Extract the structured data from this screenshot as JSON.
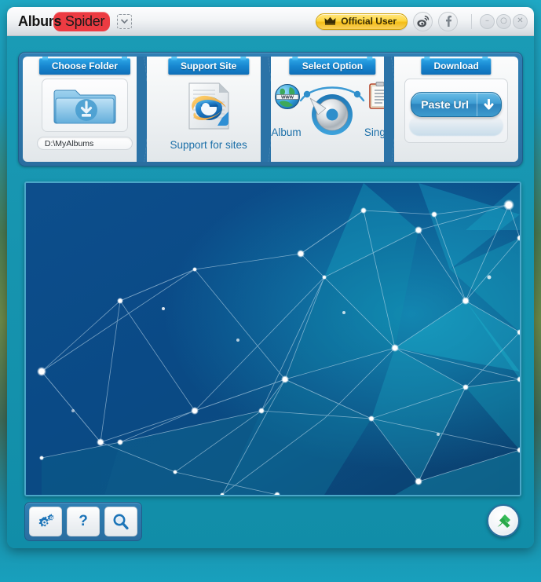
{
  "window": {
    "logo_primary": "Album",
    "logo_pill_bold": "s",
    "logo_pill_rest": "Spider",
    "dropdown_icon": "chevron-down-icon",
    "official_badge": "Official User",
    "badge_icon": "crown-icon",
    "social": [
      {
        "name": "weibo-icon",
        "glyph": "◉"
      },
      {
        "name": "facebook-icon",
        "glyph": "f"
      }
    ],
    "controls": [
      {
        "name": "minimize-button",
        "glyph": "–"
      },
      {
        "name": "maximize-button",
        "glyph": "○"
      },
      {
        "name": "close-button",
        "glyph": "✕"
      }
    ]
  },
  "toolbar": {
    "tabs": [
      {
        "label": "Choose Folder"
      },
      {
        "label": "Support Site"
      },
      {
        "label": "Select Option"
      },
      {
        "label": "Download"
      }
    ],
    "choose_folder": {
      "icon": "download-folder-icon",
      "path_value": "D:\\MyAlbums",
      "path_placeholder": "D:\\MyAlbums"
    },
    "support_site": {
      "icon": "internet-explorer-document-icon",
      "caption": "Support for sites"
    },
    "select_option": {
      "left_label": "Album",
      "right_label": "Single",
      "left_icon": "www-globe-icon",
      "right_icon": "clipboard-icon",
      "dial_icon": "rotary-dial-knob",
      "selected": "Album"
    },
    "download": {
      "button_label": "Paste Url",
      "button_icon": "download-arrow-icon"
    }
  },
  "preview": {
    "name": "preview-image-network-background",
    "alt": "Low-poly network constellation background"
  },
  "bottom": {
    "buttons": [
      {
        "name": "settings-button",
        "icon": "gears-icon"
      },
      {
        "name": "help-button",
        "icon": "question-mark-icon",
        "glyph": "?"
      },
      {
        "name": "search-button",
        "icon": "magnifier-icon"
      }
    ],
    "corner_button": {
      "name": "xunlei-button",
      "icon": "satellite-dish-icon"
    }
  },
  "colors": {
    "window_body": "#1795b0",
    "panel_blue": "#2e7fb4",
    "tab_blue": "#1786cf",
    "badge_yellow": "#ffd73f",
    "logo_red": "#ec3b42",
    "link_blue": "#1b6fa8",
    "preview_dark": "#0b4a84",
    "preview_cyan": "#1fb6cf"
  }
}
